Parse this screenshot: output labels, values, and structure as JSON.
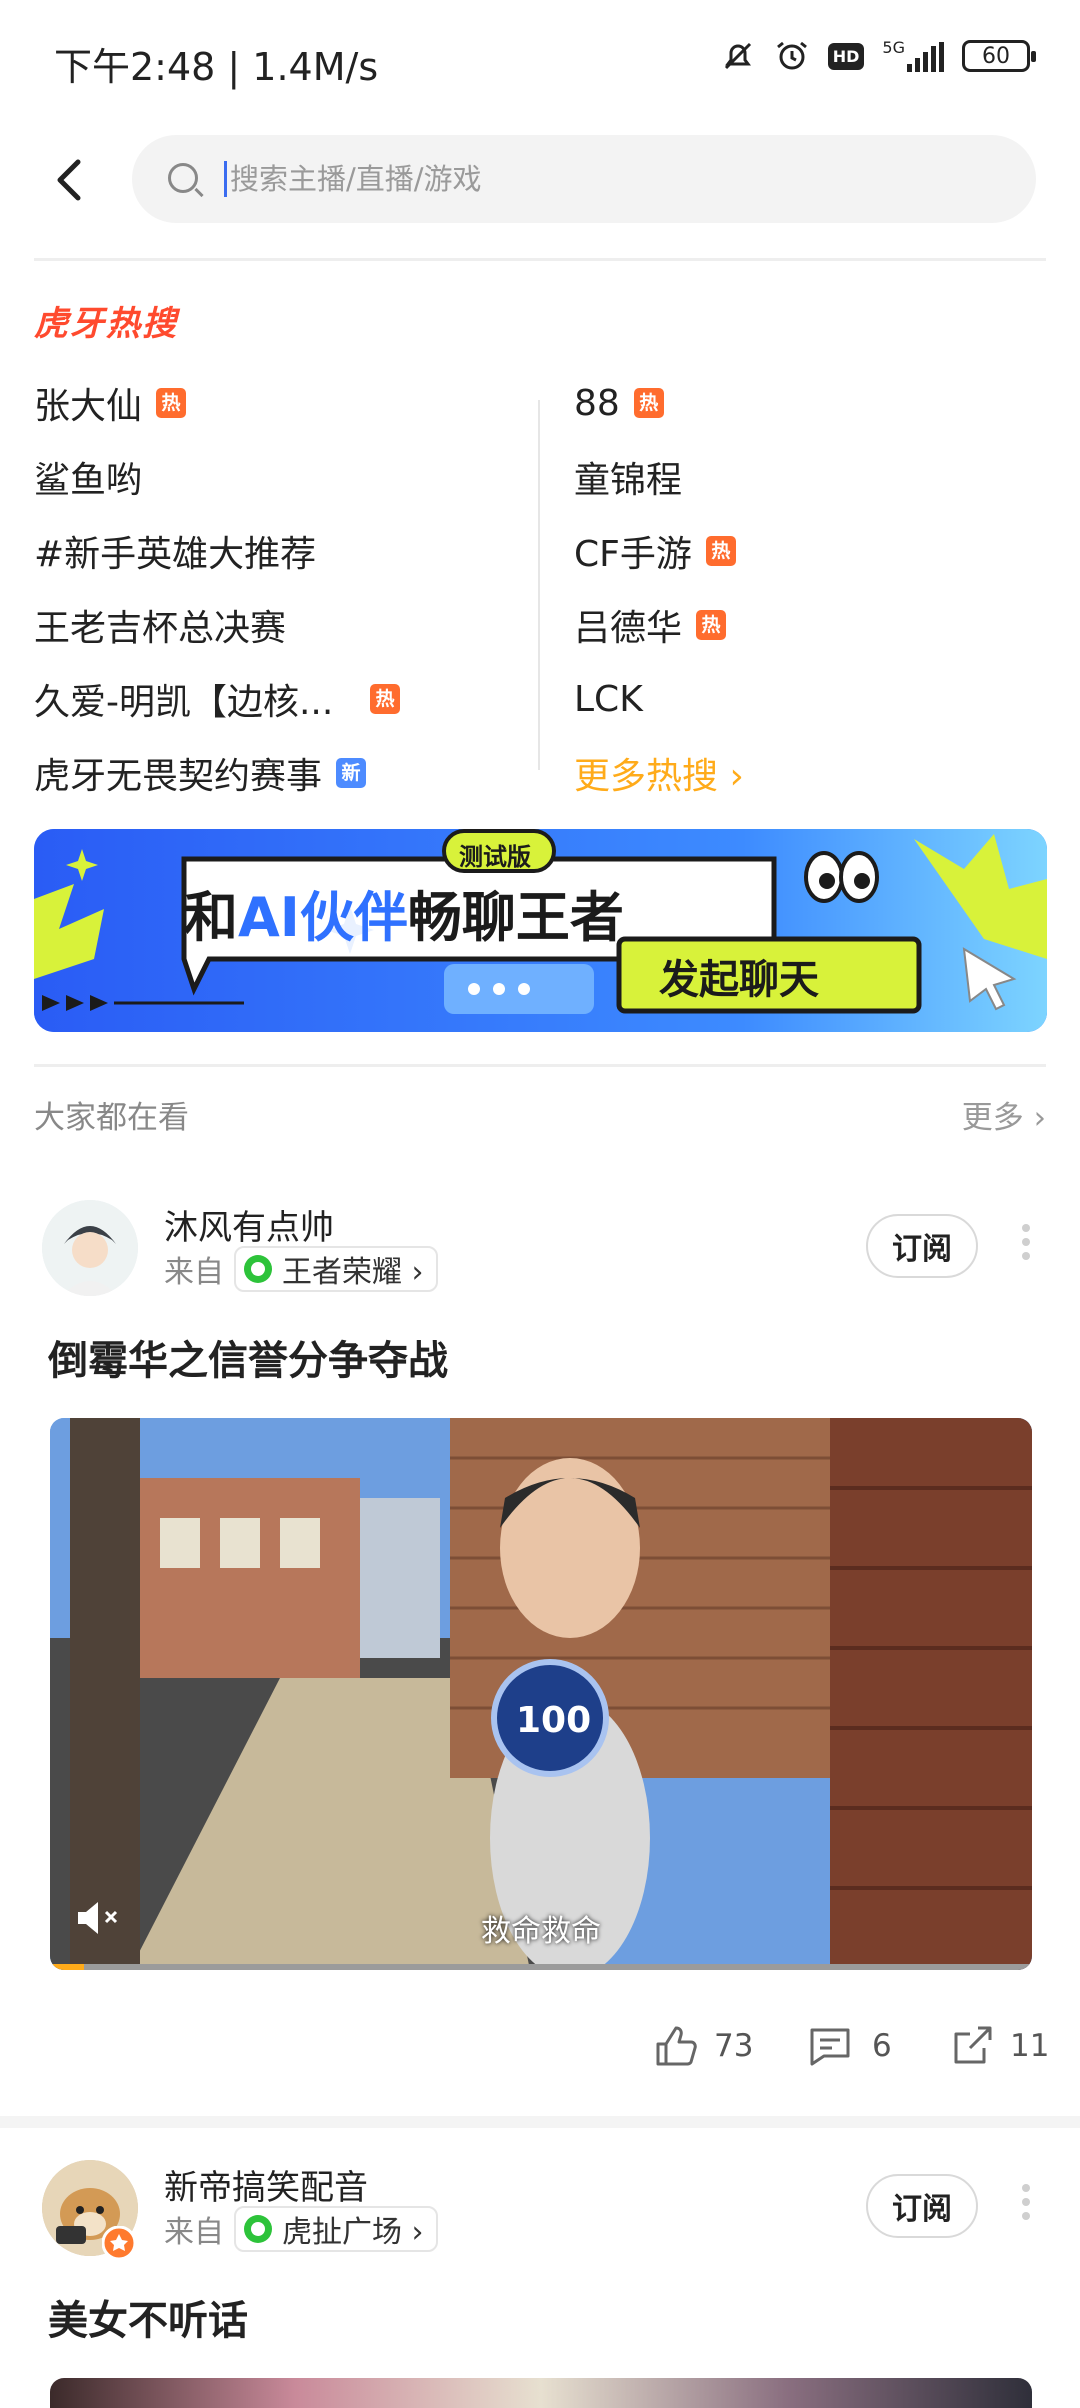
{
  "status_bar": {
    "time": "下午2:48 | 1.4M/s",
    "network": "5G",
    "hd": "HD",
    "battery": "60",
    "icons": [
      "mute-bell-icon",
      "alarm-icon",
      "hd-icon",
      "signal-icon",
      "battery-icon"
    ]
  },
  "search": {
    "placeholder": "搜索主播/直播/游戏",
    "value": ""
  },
  "hot": {
    "title": "虎牙热搜",
    "left": [
      {
        "text": "张大仙",
        "tag": "热"
      },
      {
        "text": "鲨鱼哟",
        "tag": ""
      },
      {
        "text": "#新手英雄大推荐",
        "tag": ""
      },
      {
        "text": "王老吉杯总决赛",
        "tag": ""
      },
      {
        "text": "久爱-明凯【边核...",
        "tag": "热"
      },
      {
        "text": "虎牙无畏契约赛事",
        "tag": "新"
      }
    ],
    "right": [
      {
        "text": "88",
        "tag": "热"
      },
      {
        "text": "童锦程",
        "tag": ""
      },
      {
        "text": "CF手游",
        "tag": "热"
      },
      {
        "text": "吕德华",
        "tag": "热"
      },
      {
        "text": "LCK",
        "tag": ""
      }
    ],
    "more": "更多热搜 ›"
  },
  "banner": {
    "badge": "测试版",
    "headline_a": "和",
    "headline_ai": "AI伙伴",
    "headline_b": "畅聊王者",
    "cta": "发起聊天",
    "colors": {
      "bg": "#2f71ff",
      "accent": "#d8f23a",
      "text": "#1b1b1b"
    }
  },
  "section": {
    "title": "大家都在看",
    "more": "更多 ›"
  },
  "posts": [
    {
      "author": "沐风有点帅",
      "from_label": "来自",
      "channel": "王者荣耀 ›",
      "subscribe": "订阅",
      "title": "倒霉华之信誉分争夺战",
      "video_score": "100",
      "video_caption": "救命救命",
      "likes": "73",
      "comments": "6",
      "shares": "11"
    },
    {
      "author": "新帝搞笑配音",
      "from_label": "来自",
      "channel": "虎扯广场 ›",
      "subscribe": "订阅",
      "title": "美女不听话"
    }
  ]
}
